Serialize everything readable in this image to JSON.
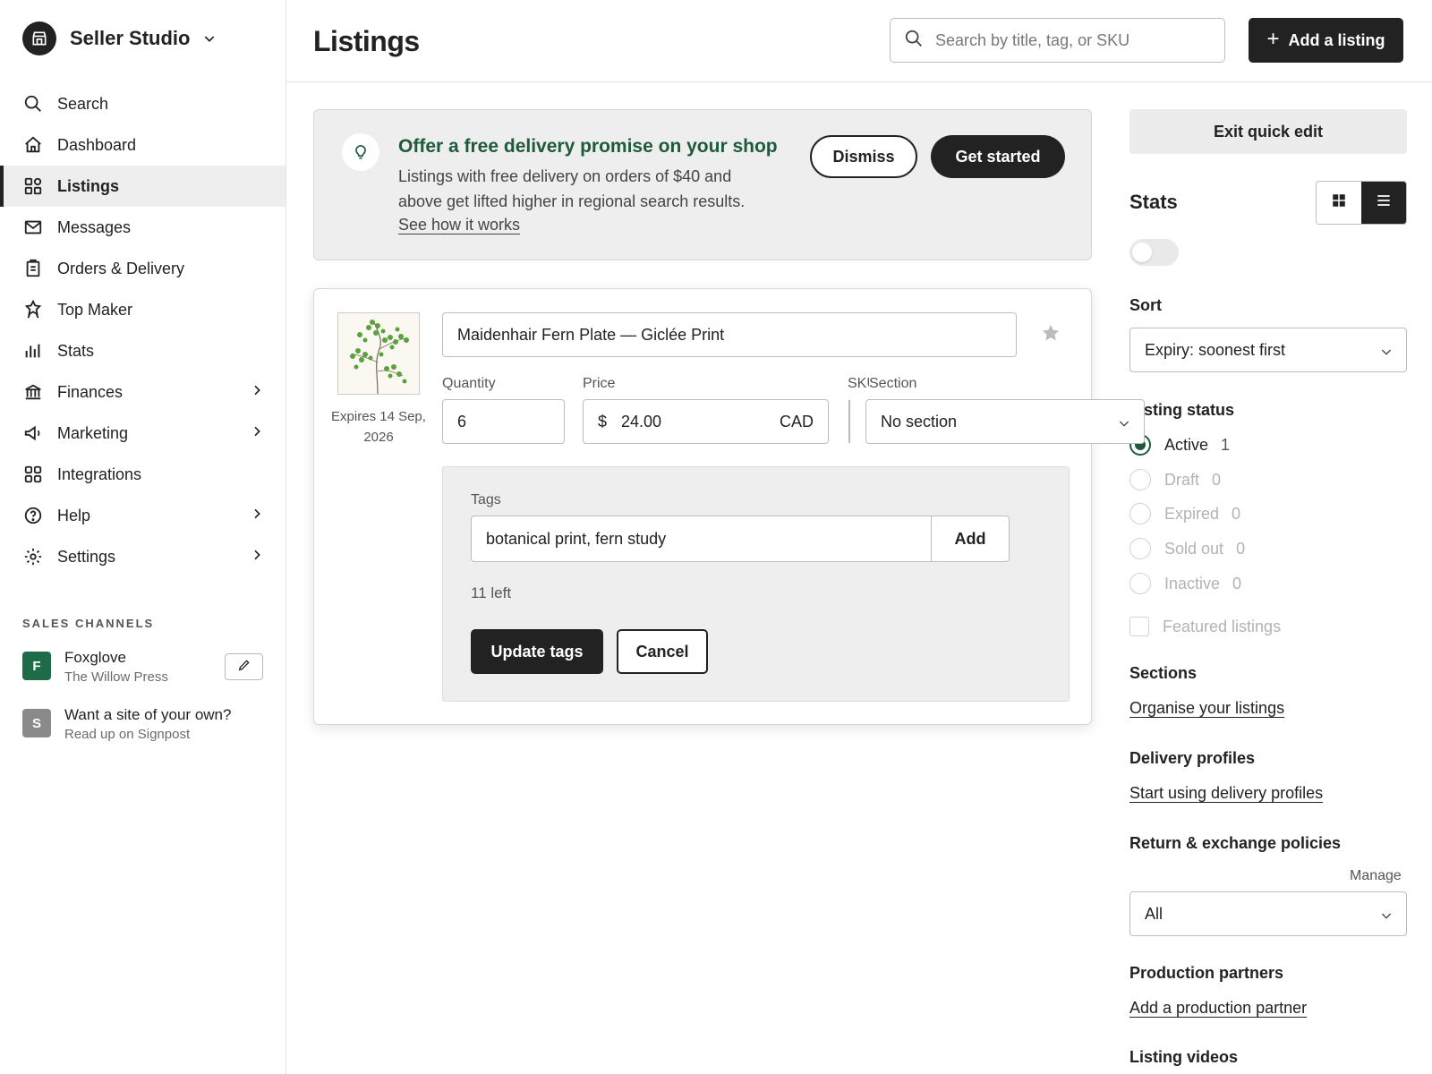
{
  "sidebar": {
    "shop_name": "Seller Studio",
    "nav": [
      {
        "label": "Search",
        "icon": "search-icon"
      },
      {
        "label": "Dashboard",
        "icon": "home-icon"
      },
      {
        "label": "Listings",
        "icon": "listings-icon",
        "active": true
      },
      {
        "label": "Messages",
        "icon": "mail-icon"
      },
      {
        "label": "Orders & Delivery",
        "icon": "clipboard-icon"
      },
      {
        "label": "Top Maker",
        "icon": "award-icon"
      },
      {
        "label": "Stats",
        "icon": "bar-chart-icon"
      },
      {
        "label": "Finances",
        "icon": "bank-icon",
        "has_children": true
      },
      {
        "label": "Marketing",
        "icon": "megaphone-icon",
        "has_children": true
      },
      {
        "label": "Integrations",
        "icon": "grid-icon"
      },
      {
        "label": "Help",
        "icon": "help-icon",
        "has_children": true
      },
      {
        "label": "Settings",
        "icon": "gear-icon",
        "has_children": true
      }
    ],
    "sales_channels_heading": "SALES CHANNELS",
    "channels": [
      {
        "avatar": "F",
        "title": "Foxglove",
        "subtitle": "The Willow Press",
        "color": "#1e6b4a"
      },
      {
        "avatar": "S",
        "title": "Want a site of your own?",
        "subtitle": "Read up on Signpost",
        "color": "#8a8a8a"
      }
    ]
  },
  "header": {
    "title": "Listings",
    "search_placeholder": "Search by title, tag, or SKU",
    "add_label": "Add a listing"
  },
  "promo": {
    "title": "Offer a free delivery promise on your shop",
    "body": "Listings with free delivery on orders of $40 and above get lifted higher in regional search results.",
    "link": "See how it works",
    "dismiss_label": "Dismiss",
    "start_label": "Get started",
    "title_color": "#1e5a3c"
  },
  "listing": {
    "title": "Maidenhair Fern Plate — Giclée Print",
    "expires": "Expires 14 Sep, 2026",
    "quantity_label": "Quantity",
    "quantity": "6",
    "price_label": "Price",
    "currency_symbol": "$",
    "price": "24.00",
    "currency": "CAD",
    "sku_label": "SKU",
    "section_label": "Section",
    "section_value": "No section",
    "tags_label": "Tags",
    "tags_value": "botanical print, fern study",
    "tags_add": "Add",
    "tags_left": "11 left",
    "update_label": "Update tags",
    "cancel_label": "Cancel"
  },
  "right_panel": {
    "exit_label": "Exit quick edit",
    "stats_heading": "Stats",
    "sort_heading": "Sort",
    "sort_value": "Expiry: soonest first",
    "status_heading": "Listing status",
    "statuses": [
      {
        "label": "Active",
        "count": "1",
        "selected": true
      },
      {
        "label": "Draft",
        "count": "0"
      },
      {
        "label": "Expired",
        "count": "0"
      },
      {
        "label": "Sold out",
        "count": "0"
      },
      {
        "label": "Inactive",
        "count": "0"
      }
    ],
    "featured_label": "Featured listings",
    "sections_heading": "Sections",
    "sections_link": "Organise your listings",
    "delivery_heading": "Delivery profiles",
    "delivery_link": "Start using delivery profiles",
    "returns_heading": "Return & exchange policies",
    "manage_label": "Manage",
    "returns_value": "All",
    "production_heading": "Production partners",
    "production_link": "Add a production partner",
    "videos_heading": "Listing videos",
    "accent_color": "#1e5a3c"
  }
}
